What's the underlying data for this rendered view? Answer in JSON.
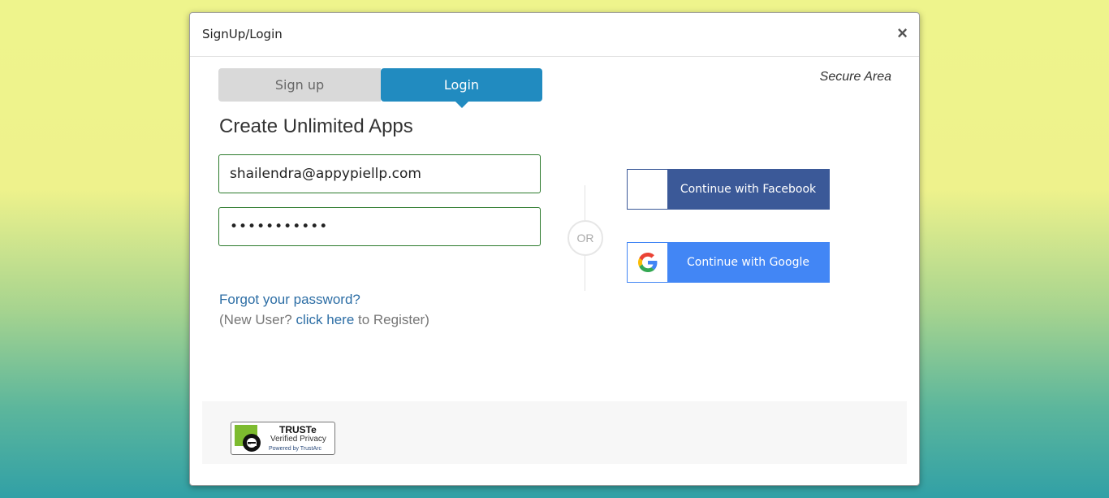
{
  "modal": {
    "title": "SignUp/Login",
    "close_label": "×"
  },
  "tabs": [
    {
      "label": "Sign up",
      "active": false
    },
    {
      "label": "Login",
      "active": true
    }
  ],
  "secure_label": "Secure Area",
  "heading": "Create Unlimited Apps",
  "form": {
    "email_value": "shailendra@appypiellp.com",
    "password_value": "•••••••••••"
  },
  "links": {
    "forgot": "Forgot your password?",
    "new_user_prefix": "(New User? ",
    "click_here": "click here",
    "new_user_suffix": " to Register)"
  },
  "or_label": "OR",
  "social": {
    "facebook_label": "Continue with Facebook",
    "google_label": "Continue with Google"
  },
  "trust": {
    "title": "TRUSTe",
    "subtitle": "Verified Privacy",
    "powered": "Powered by TrustArc"
  },
  "colors": {
    "login_tab": "#218bc0",
    "facebook": "#3b5998",
    "google": "#4286f5",
    "link": "#2d6ea5"
  },
  "icons": {
    "close": "close-icon",
    "google": "google-icon",
    "truste": "truste-logo-icon"
  }
}
